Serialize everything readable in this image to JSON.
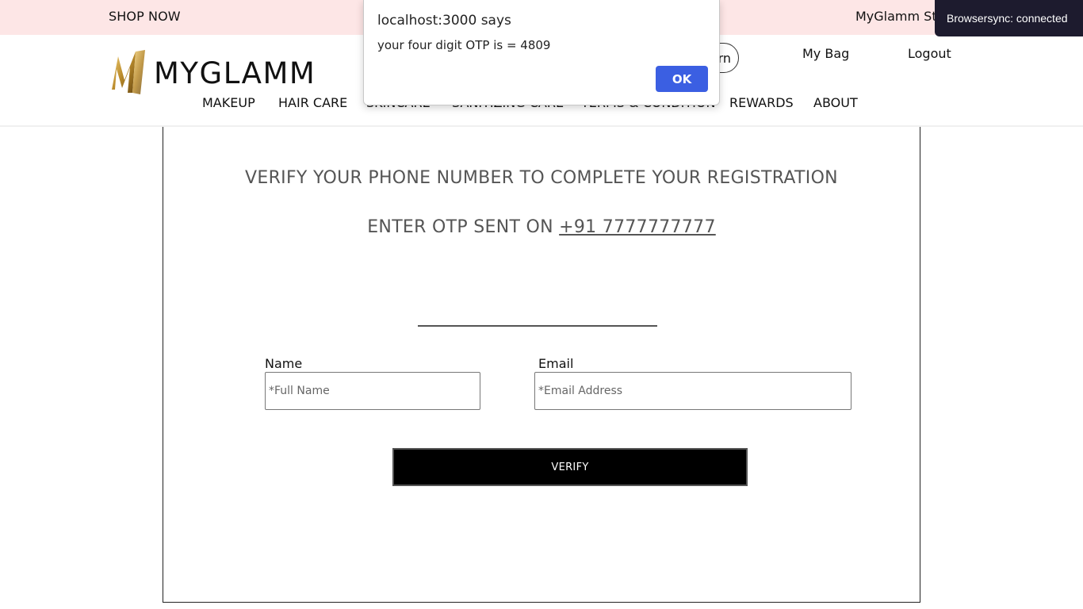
{
  "topbar": {
    "shop_now": "SHOP NOW",
    "stores": "MyGlamm Sto"
  },
  "header": {
    "logo_text": "MYGLAMM",
    "pill_text": "rn",
    "my_bag": "My Bag",
    "logout": "Logout"
  },
  "nav": {
    "items": [
      "MAKEUP",
      "HAIR CARE",
      "SKINCARE",
      "SANITIZING CARE",
      "TERMS & CONDITION",
      "REWARDS",
      "ABOUT"
    ]
  },
  "main": {
    "heading": "VERIFY YOUR PHONE NUMBER TO COMPLETE YOUR REGISTRATION",
    "otp_prefix": "ENTER OTP SENT ON ",
    "phone": "+91 7777777777",
    "otp_value": "",
    "name_label": "Name",
    "name_placeholder": "*Full Name",
    "email_label": "Email",
    "email_placeholder": "*Email Address",
    "verify_label": "VERIFY"
  },
  "alert": {
    "title": "localhost:3000 says",
    "message": "your four digit OTP is = 4809",
    "ok_label": "OK"
  },
  "browsersync": {
    "text": "Browsersync: connected"
  },
  "colors": {
    "topbar_bg": "#fde6e6",
    "primary_button": "#000000",
    "dialog_ok": "#3b5fe2",
    "browsersync_bg": "#1d1b2e",
    "logo_gold": "#c9a03c"
  }
}
